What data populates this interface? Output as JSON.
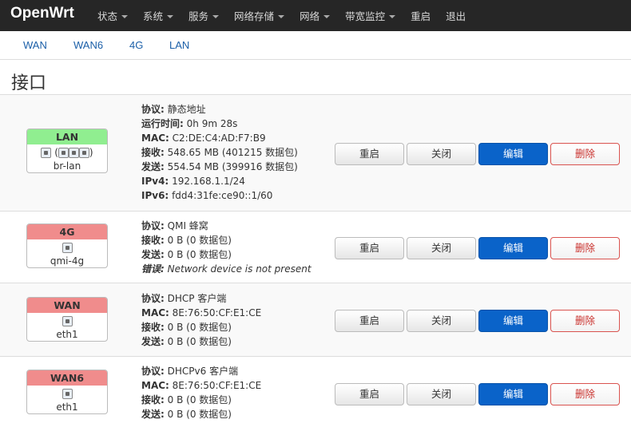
{
  "navbar": {
    "brand": "OpenWrt",
    "menu": [
      {
        "label": "状态",
        "has_caret": true
      },
      {
        "label": "系统",
        "has_caret": true
      },
      {
        "label": "服务",
        "has_caret": true
      },
      {
        "label": "网络存储",
        "has_caret": true
      },
      {
        "label": "网络",
        "has_caret": true
      },
      {
        "label": "带宽监控",
        "has_caret": true
      },
      {
        "label": "重启",
        "has_caret": false
      },
      {
        "label": "退出",
        "has_caret": false
      }
    ]
  },
  "tabs": [
    "WAN",
    "WAN6",
    "4G",
    "LAN"
  ],
  "heading": "接口",
  "colors": {
    "navbar": "#262626",
    "primary": "#0a63c9",
    "danger": "#c9302c",
    "badge_up": "#90ee90",
    "badge_down": "#f08c8c",
    "link": "#1b5fa8"
  },
  "interfaces": [
    {
      "name": "LAN",
      "badge_color": "green",
      "icons": [
        "bridge-icon",
        "ethernet-icon",
        "wifi-icon",
        "wifi-icon"
      ],
      "icons_text": "(   )",
      "device": "br-lan",
      "info": [
        {
          "k": "协议:",
          "v": "静态地址"
        },
        {
          "k": "运行时间:",
          "v": "0h 9m 28s"
        },
        {
          "k": "MAC:",
          "v": "C2:DE:C4:AD:F7:B9"
        },
        {
          "k": "接收:",
          "v": "548.65 MB (401215 数据包)"
        },
        {
          "k": "发送:",
          "v": "554.54 MB (399916 数据包)"
        },
        {
          "k": "IPv4:",
          "v": "192.168.1.1/24"
        },
        {
          "k": "IPv6:",
          "v": "fdd4:31fe:ce90::1/60"
        }
      ]
    },
    {
      "name": "4G",
      "badge_color": "red",
      "icons": [
        "ethernet-icon"
      ],
      "device": "qmi-4g",
      "info": [
        {
          "k": "协议:",
          "v": "QMI 蜂窝"
        },
        {
          "k": "接收:",
          "v": "0 B (0 数据包)"
        },
        {
          "k": "发送:",
          "v": "0 B (0 数据包)"
        },
        {
          "k": "错误:",
          "v": "Network device is not present",
          "error": true
        }
      ]
    },
    {
      "name": "WAN",
      "badge_color": "red",
      "icons": [
        "ethernet-icon"
      ],
      "device": "eth1",
      "info": [
        {
          "k": "协议:",
          "v": "DHCP 客户端"
        },
        {
          "k": "MAC:",
          "v": "8E:76:50:CF:E1:CE"
        },
        {
          "k": "接收:",
          "v": "0 B (0 数据包)"
        },
        {
          "k": "发送:",
          "v": "0 B (0 数据包)"
        }
      ]
    },
    {
      "name": "WAN6",
      "badge_color": "red",
      "icons": [
        "ethernet-icon"
      ],
      "device": "eth1",
      "info": [
        {
          "k": "协议:",
          "v": "DHCPv6 客户端"
        },
        {
          "k": "MAC:",
          "v": "8E:76:50:CF:E1:CE"
        },
        {
          "k": "接收:",
          "v": "0 B (0 数据包)"
        },
        {
          "k": "发送:",
          "v": "0 B (0 数据包)"
        }
      ]
    }
  ],
  "buttons": {
    "restart": "重启",
    "stop": "关闭",
    "edit": "编辑",
    "delete": "删除"
  }
}
